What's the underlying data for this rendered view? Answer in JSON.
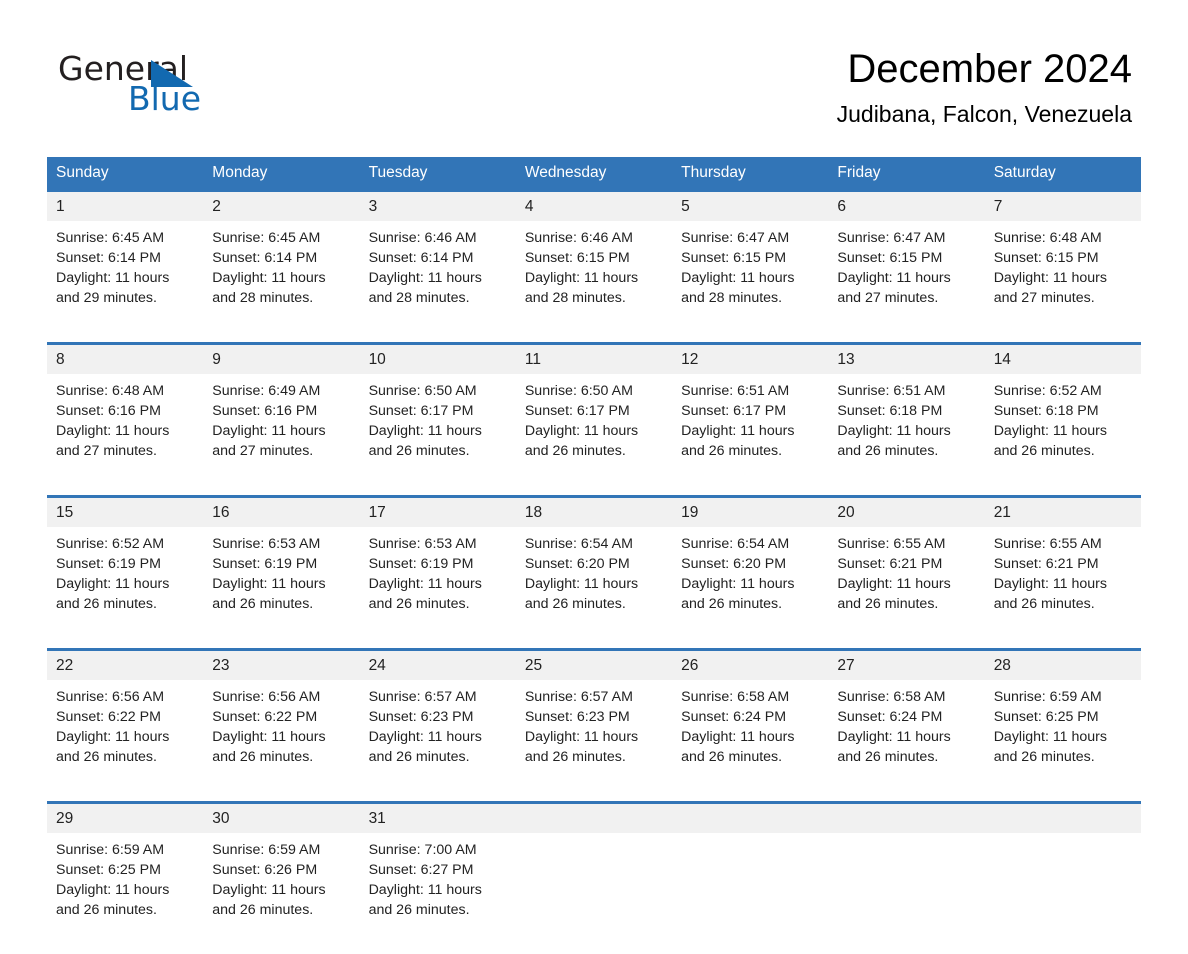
{
  "brand": {
    "name_part1": "General",
    "name_part2": "Blue",
    "logo_icon": "blue-triangle-icon",
    "accent_color": "#1269b0"
  },
  "header": {
    "title": "December 2024",
    "subtitle": "Judibana, Falcon, Venezuela"
  },
  "theme": {
    "header_bg": "#3275b7",
    "header_text": "#ffffff",
    "date_band_bg": "#f1f1f1",
    "row_divider": "#3275b7"
  },
  "calendar": {
    "weekday_headers": [
      "Sunday",
      "Monday",
      "Tuesday",
      "Wednesday",
      "Thursday",
      "Friday",
      "Saturday"
    ],
    "weeks": [
      [
        {
          "day": "1",
          "sunrise": "Sunrise: 6:45 AM",
          "sunset": "Sunset: 6:14 PM",
          "daylight": "Daylight: 11 hours and 29 minutes."
        },
        {
          "day": "2",
          "sunrise": "Sunrise: 6:45 AM",
          "sunset": "Sunset: 6:14 PM",
          "daylight": "Daylight: 11 hours and 28 minutes."
        },
        {
          "day": "3",
          "sunrise": "Sunrise: 6:46 AM",
          "sunset": "Sunset: 6:14 PM",
          "daylight": "Daylight: 11 hours and 28 minutes."
        },
        {
          "day": "4",
          "sunrise": "Sunrise: 6:46 AM",
          "sunset": "Sunset: 6:15 PM",
          "daylight": "Daylight: 11 hours and 28 minutes."
        },
        {
          "day": "5",
          "sunrise": "Sunrise: 6:47 AM",
          "sunset": "Sunset: 6:15 PM",
          "daylight": "Daylight: 11 hours and 28 minutes."
        },
        {
          "day": "6",
          "sunrise": "Sunrise: 6:47 AM",
          "sunset": "Sunset: 6:15 PM",
          "daylight": "Daylight: 11 hours and 27 minutes."
        },
        {
          "day": "7",
          "sunrise": "Sunrise: 6:48 AM",
          "sunset": "Sunset: 6:15 PM",
          "daylight": "Daylight: 11 hours and 27 minutes."
        }
      ],
      [
        {
          "day": "8",
          "sunrise": "Sunrise: 6:48 AM",
          "sunset": "Sunset: 6:16 PM",
          "daylight": "Daylight: 11 hours and 27 minutes."
        },
        {
          "day": "9",
          "sunrise": "Sunrise: 6:49 AM",
          "sunset": "Sunset: 6:16 PM",
          "daylight": "Daylight: 11 hours and 27 minutes."
        },
        {
          "day": "10",
          "sunrise": "Sunrise: 6:50 AM",
          "sunset": "Sunset: 6:17 PM",
          "daylight": "Daylight: 11 hours and 26 minutes."
        },
        {
          "day": "11",
          "sunrise": "Sunrise: 6:50 AM",
          "sunset": "Sunset: 6:17 PM",
          "daylight": "Daylight: 11 hours and 26 minutes."
        },
        {
          "day": "12",
          "sunrise": "Sunrise: 6:51 AM",
          "sunset": "Sunset: 6:17 PM",
          "daylight": "Daylight: 11 hours and 26 minutes."
        },
        {
          "day": "13",
          "sunrise": "Sunrise: 6:51 AM",
          "sunset": "Sunset: 6:18 PM",
          "daylight": "Daylight: 11 hours and 26 minutes."
        },
        {
          "day": "14",
          "sunrise": "Sunrise: 6:52 AM",
          "sunset": "Sunset: 6:18 PM",
          "daylight": "Daylight: 11 hours and 26 minutes."
        }
      ],
      [
        {
          "day": "15",
          "sunrise": "Sunrise: 6:52 AM",
          "sunset": "Sunset: 6:19 PM",
          "daylight": "Daylight: 11 hours and 26 minutes."
        },
        {
          "day": "16",
          "sunrise": "Sunrise: 6:53 AM",
          "sunset": "Sunset: 6:19 PM",
          "daylight": "Daylight: 11 hours and 26 minutes."
        },
        {
          "day": "17",
          "sunrise": "Sunrise: 6:53 AM",
          "sunset": "Sunset: 6:19 PM",
          "daylight": "Daylight: 11 hours and 26 minutes."
        },
        {
          "day": "18",
          "sunrise": "Sunrise: 6:54 AM",
          "sunset": "Sunset: 6:20 PM",
          "daylight": "Daylight: 11 hours and 26 minutes."
        },
        {
          "day": "19",
          "sunrise": "Sunrise: 6:54 AM",
          "sunset": "Sunset: 6:20 PM",
          "daylight": "Daylight: 11 hours and 26 minutes."
        },
        {
          "day": "20",
          "sunrise": "Sunrise: 6:55 AM",
          "sunset": "Sunset: 6:21 PM",
          "daylight": "Daylight: 11 hours and 26 minutes."
        },
        {
          "day": "21",
          "sunrise": "Sunrise: 6:55 AM",
          "sunset": "Sunset: 6:21 PM",
          "daylight": "Daylight: 11 hours and 26 minutes."
        }
      ],
      [
        {
          "day": "22",
          "sunrise": "Sunrise: 6:56 AM",
          "sunset": "Sunset: 6:22 PM",
          "daylight": "Daylight: 11 hours and 26 minutes."
        },
        {
          "day": "23",
          "sunrise": "Sunrise: 6:56 AM",
          "sunset": "Sunset: 6:22 PM",
          "daylight": "Daylight: 11 hours and 26 minutes."
        },
        {
          "day": "24",
          "sunrise": "Sunrise: 6:57 AM",
          "sunset": "Sunset: 6:23 PM",
          "daylight": "Daylight: 11 hours and 26 minutes."
        },
        {
          "day": "25",
          "sunrise": "Sunrise: 6:57 AM",
          "sunset": "Sunset: 6:23 PM",
          "daylight": "Daylight: 11 hours and 26 minutes."
        },
        {
          "day": "26",
          "sunrise": "Sunrise: 6:58 AM",
          "sunset": "Sunset: 6:24 PM",
          "daylight": "Daylight: 11 hours and 26 minutes."
        },
        {
          "day": "27",
          "sunrise": "Sunrise: 6:58 AM",
          "sunset": "Sunset: 6:24 PM",
          "daylight": "Daylight: 11 hours and 26 minutes."
        },
        {
          "day": "28",
          "sunrise": "Sunrise: 6:59 AM",
          "sunset": "Sunset: 6:25 PM",
          "daylight": "Daylight: 11 hours and 26 minutes."
        }
      ],
      [
        {
          "day": "29",
          "sunrise": "Sunrise: 6:59 AM",
          "sunset": "Sunset: 6:25 PM",
          "daylight": "Daylight: 11 hours and 26 minutes."
        },
        {
          "day": "30",
          "sunrise": "Sunrise: 6:59 AM",
          "sunset": "Sunset: 6:26 PM",
          "daylight": "Daylight: 11 hours and 26 minutes."
        },
        {
          "day": "31",
          "sunrise": "Sunrise: 7:00 AM",
          "sunset": "Sunset: 6:27 PM",
          "daylight": "Daylight: 11 hours and 26 minutes."
        },
        {
          "day": "",
          "sunrise": "",
          "sunset": "",
          "daylight": ""
        },
        {
          "day": "",
          "sunrise": "",
          "sunset": "",
          "daylight": ""
        },
        {
          "day": "",
          "sunrise": "",
          "sunset": "",
          "daylight": ""
        },
        {
          "day": "",
          "sunrise": "",
          "sunset": "",
          "daylight": ""
        }
      ]
    ]
  }
}
